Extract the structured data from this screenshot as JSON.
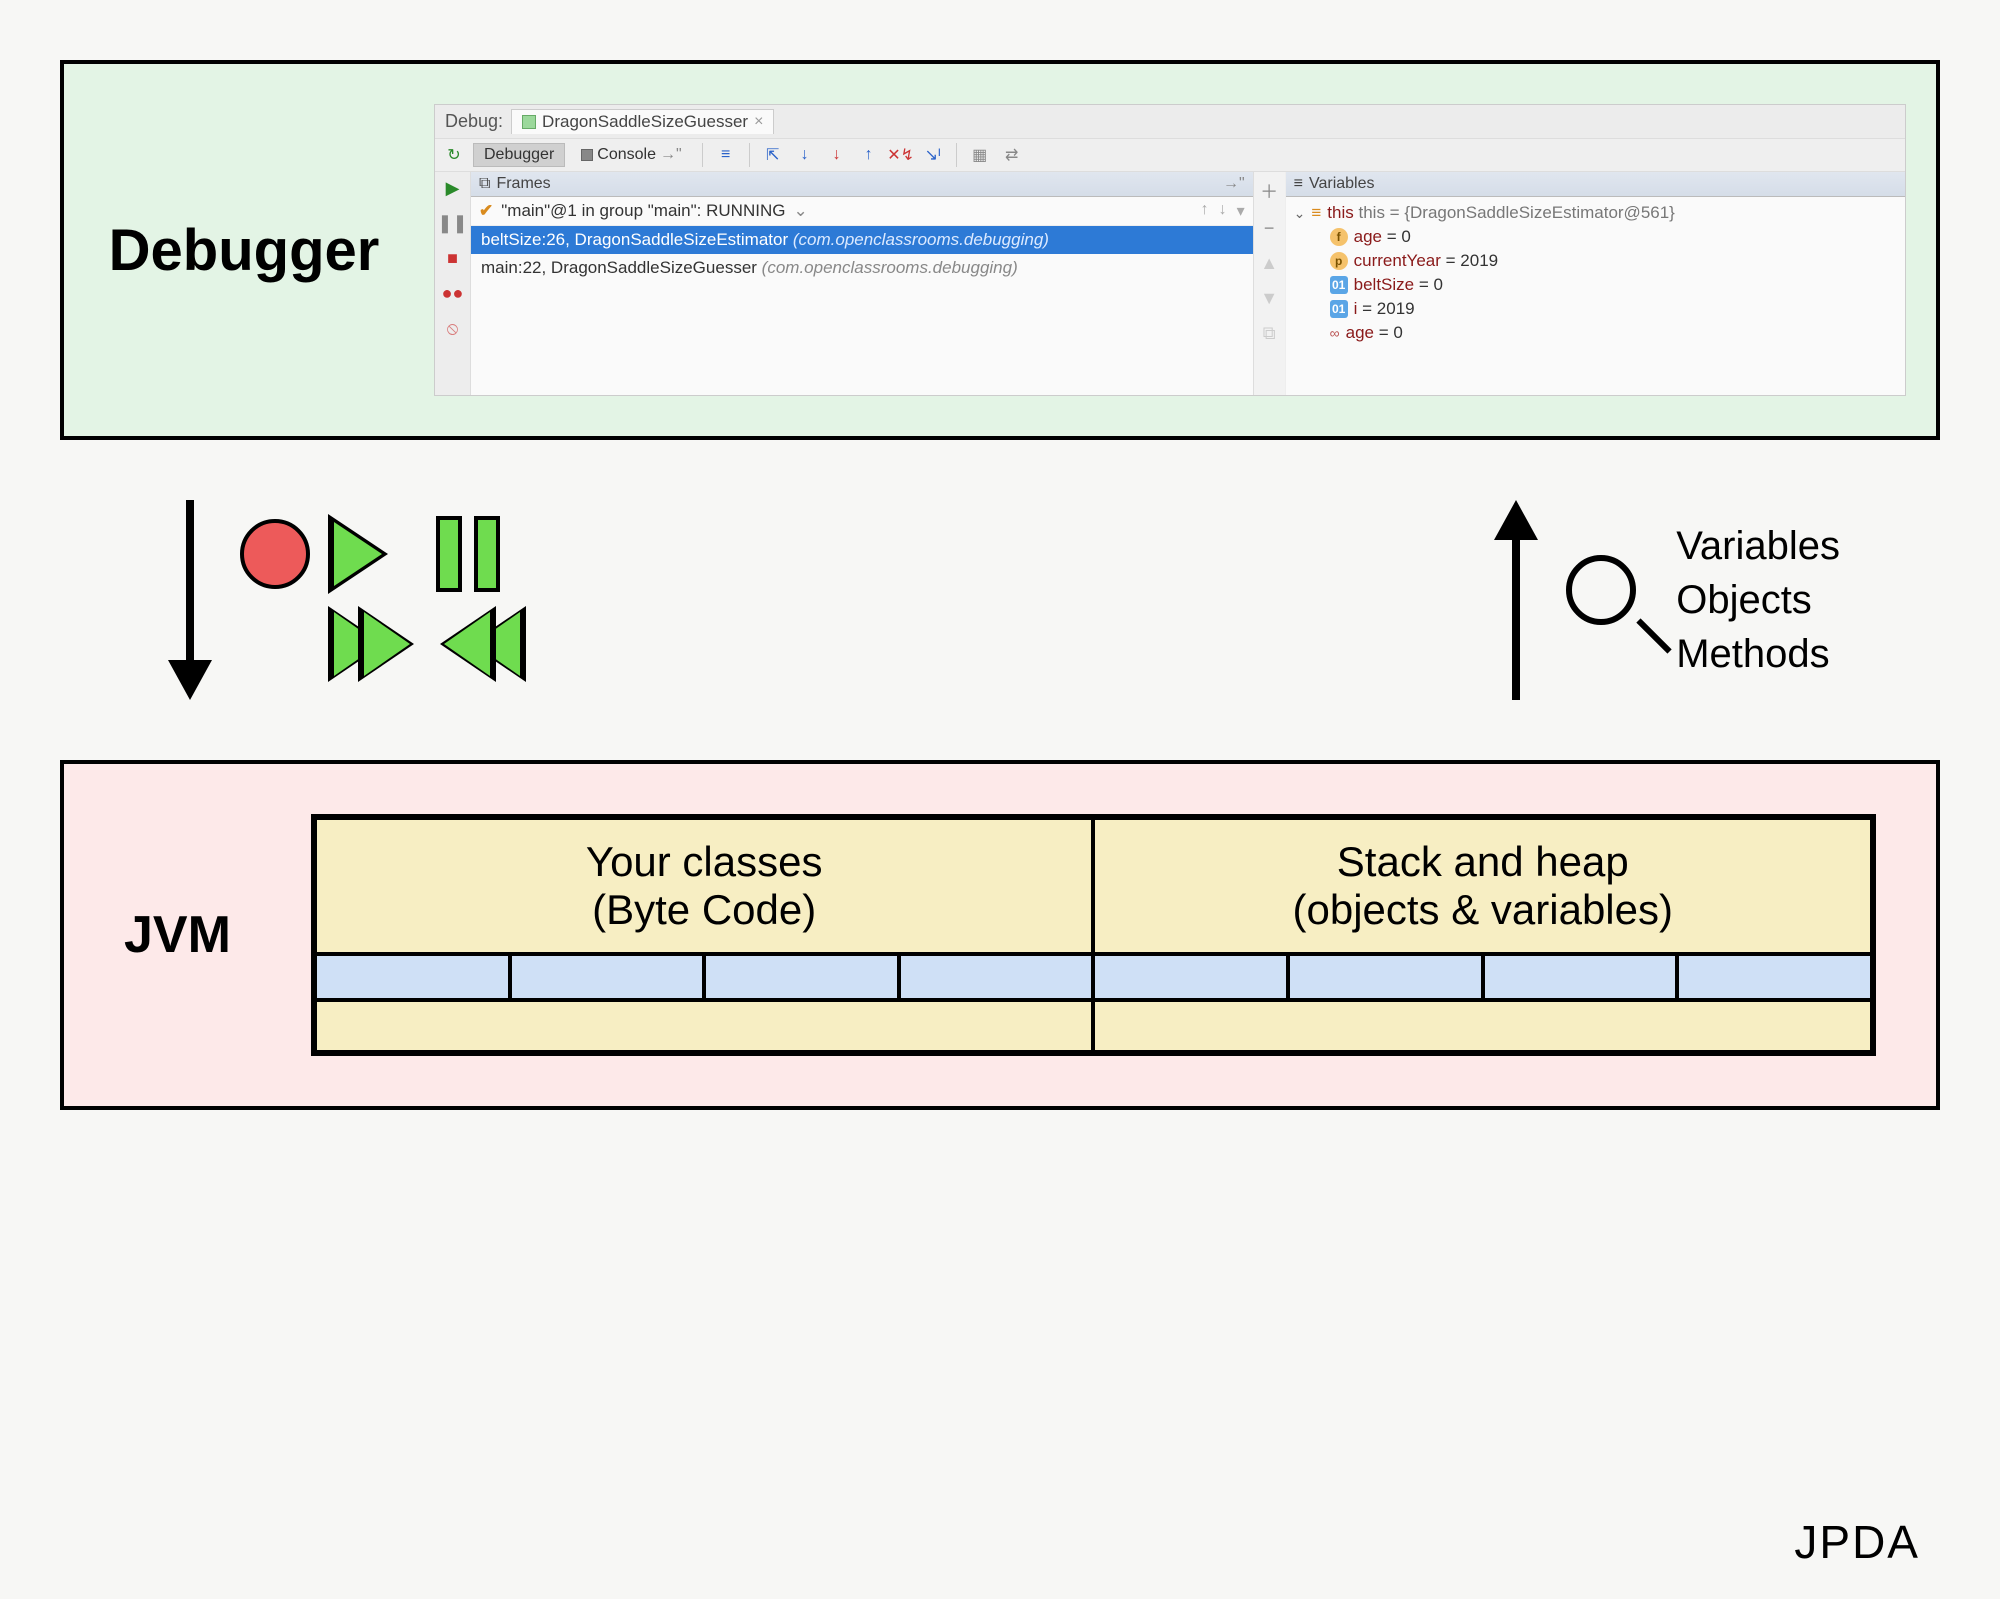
{
  "labels": {
    "debugger": "Debugger",
    "jvm": "JVM",
    "jpda": "JPDA"
  },
  "ide": {
    "debug_label": "Debug:",
    "run_config": "DragonSaddleSizeGuesser",
    "tabs": {
      "debugger": "Debugger",
      "console": "Console"
    },
    "frames_header": "Frames",
    "variables_header": "Variables",
    "thread_line": "\"main\"@1 in group \"main\": RUNNING",
    "frames": [
      {
        "text": "beltSize:26, DragonSaddleSizeEstimator",
        "pkg": "(com.openclassrooms.debugging)",
        "selected": true
      },
      {
        "text": "main:22, DragonSaddleSizeGuesser",
        "pkg": "(com.openclassrooms.debugging)",
        "selected": false
      }
    ],
    "variables": {
      "this_line": "this = {DragonSaddleSizeEstimator@561}",
      "items": [
        {
          "badge": "f",
          "cls": "b-orange-f",
          "name": "age",
          "val": " = 0"
        },
        {
          "badge": "p",
          "cls": "b-orange-p",
          "name": "currentYear",
          "val": " = 2019"
        },
        {
          "badge": "01",
          "cls": "b-blue",
          "name": "beltSize",
          "val": " = 0"
        },
        {
          "badge": "01",
          "cls": "b-blue",
          "name": "i",
          "val": " = 2019"
        },
        {
          "badge": "oo",
          "cls": "b-hollow",
          "name": "age",
          "val": " = 0"
        }
      ]
    }
  },
  "right_list": {
    "l1": "Variables",
    "l2": "Objects",
    "l3": "Methods"
  },
  "jvm_cells": {
    "left_top": "Your classes",
    "left_bottom": "(Byte Code)",
    "right_top": "Stack and heap",
    "right_bottom": "(objects & variables)"
  }
}
